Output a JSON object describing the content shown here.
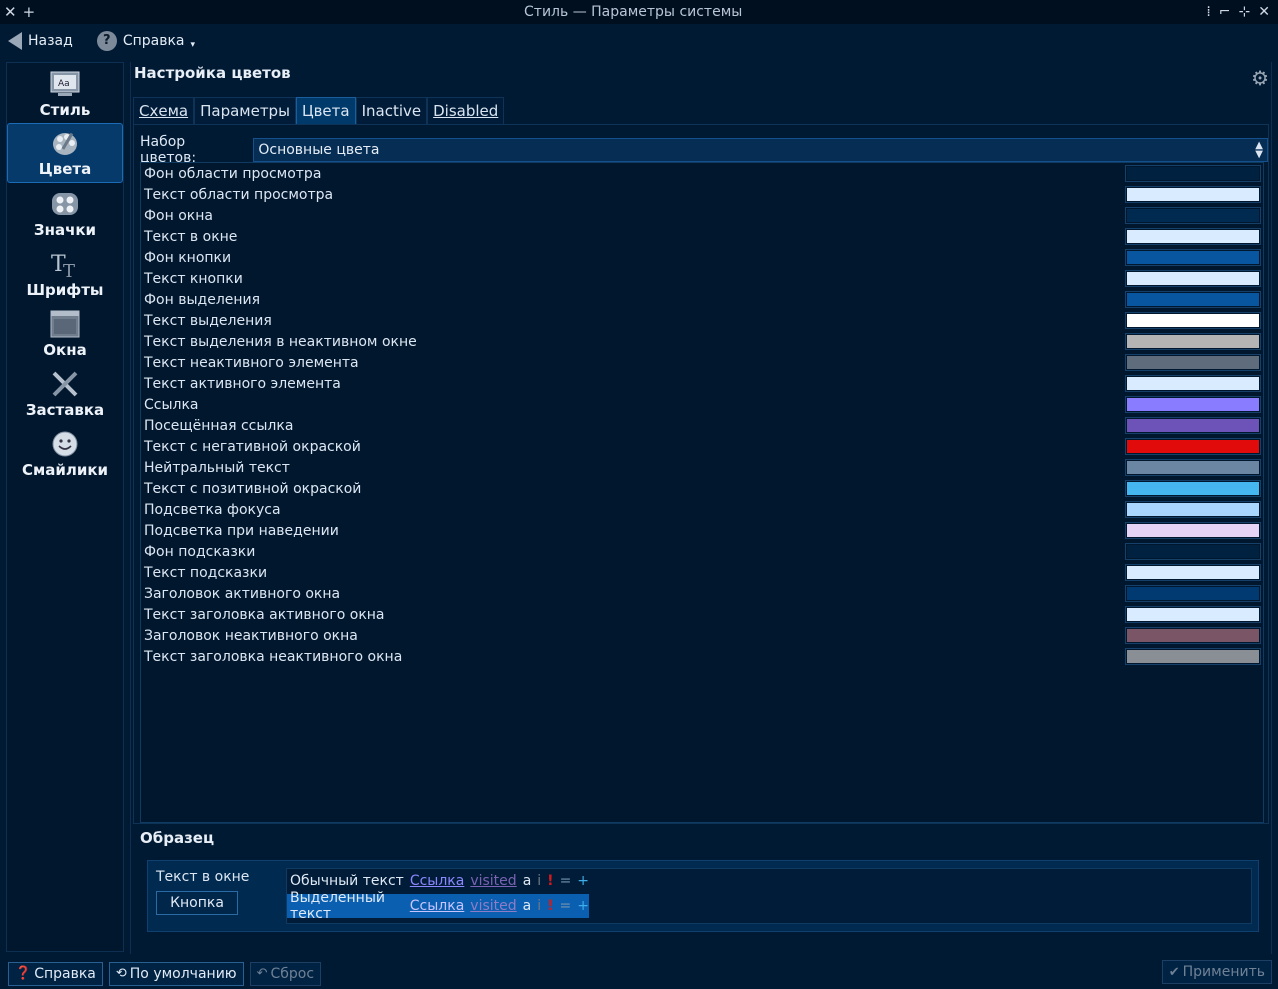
{
  "window": {
    "title": "Стиль — Параметры системы"
  },
  "toolbar": {
    "back_label": "Назад",
    "help_label": "Справка"
  },
  "sidebar": {
    "items": [
      {
        "label": "Стиль",
        "icon": "style-icon"
      },
      {
        "label": "Цвета",
        "icon": "colors-icon"
      },
      {
        "label": "Значки",
        "icon": "icons-icon"
      },
      {
        "label": "Шрифты",
        "icon": "fonts-icon"
      },
      {
        "label": "Окна",
        "icon": "windows-icon"
      },
      {
        "label": "Заставка",
        "icon": "splash-icon"
      },
      {
        "label": "Смайлики",
        "icon": "emoticons-icon"
      }
    ],
    "active_index": 1
  },
  "page": {
    "title": "Настройка цветов"
  },
  "tabs": [
    {
      "label": "Схема"
    },
    {
      "label": "Параметры"
    },
    {
      "label": "Цвета"
    },
    {
      "label": "Inactive"
    },
    {
      "label": "Disabled"
    }
  ],
  "color_set": {
    "label": "Набор цветов:",
    "value": "Основные цвета"
  },
  "colors": [
    {
      "label": "Фон области просмотра",
      "color": "#00213f"
    },
    {
      "label": "Текст области просмотра",
      "color": "#d9ecff"
    },
    {
      "label": "Фон окна",
      "color": "#002a50"
    },
    {
      "label": "Текст в окне",
      "color": "#d9ecff"
    },
    {
      "label": "Фон кнопки",
      "color": "#0856a0"
    },
    {
      "label": "Текст кнопки",
      "color": "#d9ecff"
    },
    {
      "label": "Фон выделения",
      "color": "#0856a0"
    },
    {
      "label": "Текст выделения",
      "color": "#ffffff"
    },
    {
      "label": "Текст выделения в неактивном окне",
      "color": "#b4b4b4"
    },
    {
      "label": "Текст неактивного элемента",
      "color": "#5f6c7b"
    },
    {
      "label": "Текст активного элемента",
      "color": "#d9ecff"
    },
    {
      "label": "Ссылка",
      "color": "#8a7cff"
    },
    {
      "label": "Посещённая ссылка",
      "color": "#6d52b8"
    },
    {
      "label": "Текст с негативной окраской",
      "color": "#e10b0b"
    },
    {
      "label": "Нейтральный текст",
      "color": "#6a86a3"
    },
    {
      "label": "Текст с позитивной окраской",
      "color": "#46b6f0"
    },
    {
      "label": "Подсветка фокуса",
      "color": "#a8d6ff"
    },
    {
      "label": "Подсветка при наведении",
      "color": "#e6d4f7"
    },
    {
      "label": "Фон подсказки",
      "color": "#00213f"
    },
    {
      "label": "Текст подсказки",
      "color": "#d9ecff"
    },
    {
      "label": "Заголовок активного окна",
      "color": "#003a70"
    },
    {
      "label": "Текст заголовка активного окна",
      "color": "#d9ecff"
    },
    {
      "label": "Заголовок неактивного окна",
      "color": "#7a5566"
    },
    {
      "label": "Текст заголовка неактивного окна",
      "color": "#8a8e95"
    }
  ],
  "sample": {
    "title": "Образец",
    "window_text": "Текст в окне",
    "button_label": "Кнопка",
    "normal_text": "Обычный текст",
    "selected_text": "Выделенный текст",
    "link": "Ссылка",
    "visited": "visited",
    "active": "a",
    "inactive": "i",
    "negative": "!",
    "neutral": "=",
    "positive": "+"
  },
  "footer": {
    "help_label": "Справка",
    "defaults_label": "По умолчанию",
    "reset_label": "Сброс",
    "apply_label": "Применить"
  }
}
